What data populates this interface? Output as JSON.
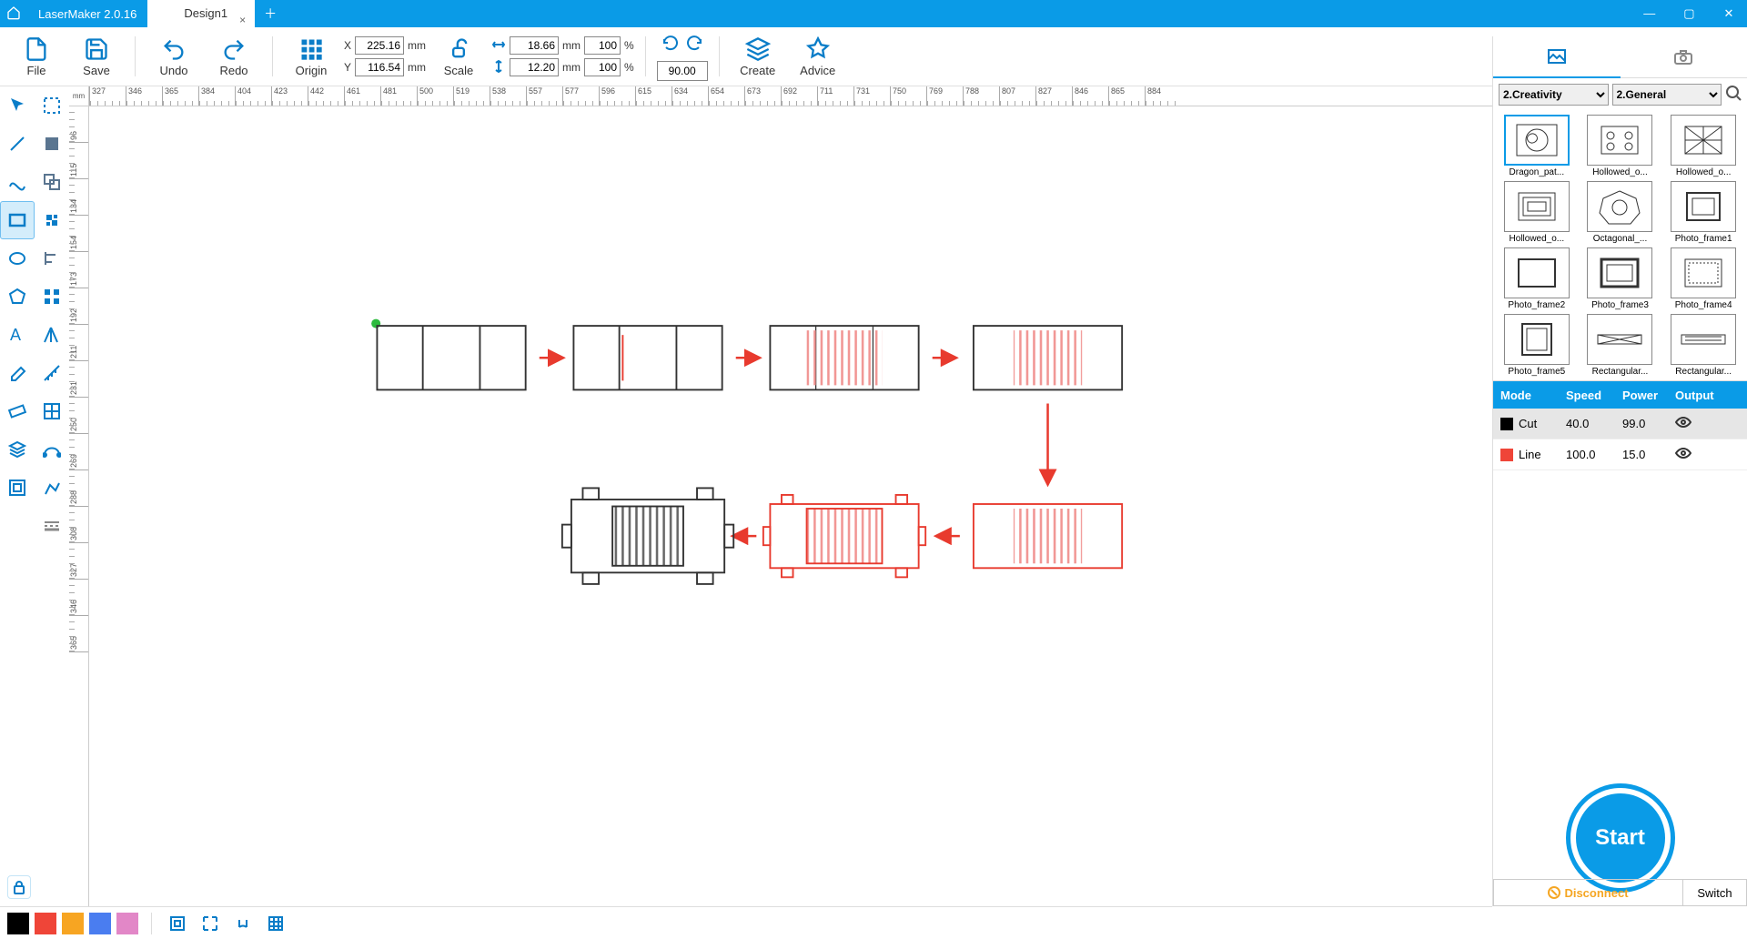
{
  "app": {
    "name": "LaserMaker 2.0.16",
    "tab": "Design1"
  },
  "toolbar": {
    "file": "File",
    "save": "Save",
    "undo": "Undo",
    "redo": "Redo",
    "origin": "Origin",
    "scale": "Scale",
    "create": "Create",
    "advice": "Advice",
    "x_label": "X",
    "y_label": "Y",
    "x_val": "225.16",
    "y_val": "116.54",
    "w_val": "18.66",
    "h_val": "12.20",
    "wp": "100",
    "hp": "100",
    "angle": "90.00",
    "mm": "mm",
    "pct": "%"
  },
  "ruler_corner": "mm",
  "h_ticks": [
    "327",
    "346",
    "365",
    "384",
    "404",
    "423",
    "442",
    "461",
    "481",
    "500",
    "519",
    "538",
    "557",
    "577",
    "596",
    "615",
    "634",
    "654",
    "673",
    "692",
    "711",
    "731",
    "750",
    "769",
    "788",
    "807",
    "827",
    "846",
    "865",
    "884"
  ],
  "v_ticks": [
    "96",
    "115",
    "134",
    "154",
    "173",
    "192",
    "211",
    "231",
    "250",
    "269",
    "288",
    "308",
    "327",
    "346",
    "365"
  ],
  "right": {
    "cat1": "2.Creativity",
    "cat2": "2.General",
    "items": [
      "Dragon_pat...",
      "Hollowed_o...",
      "Hollowed_o...",
      "Hollowed_o...",
      "Octagonal_...",
      "Photo_frame1",
      "Photo_frame2",
      "Photo_frame3",
      "Photo_frame4",
      "Photo_frame5",
      "Rectangular...",
      "Rectangular..."
    ]
  },
  "layers": {
    "hdr": {
      "mode": "Mode",
      "speed": "Speed",
      "power": "Power",
      "output": "Output"
    },
    "rows": [
      {
        "color": "#000000",
        "mode": "Cut",
        "speed": "40.0",
        "power": "99.0"
      },
      {
        "color": "#ef4538",
        "mode": "Line",
        "speed": "100.0",
        "power": "15.0"
      }
    ]
  },
  "start": "Start",
  "conn": {
    "disconnect": "Disconnect",
    "switch": "Switch"
  },
  "palette": [
    "#000000",
    "#ef4538",
    "#f7a522",
    "#4a7df0",
    "#e287c7"
  ]
}
